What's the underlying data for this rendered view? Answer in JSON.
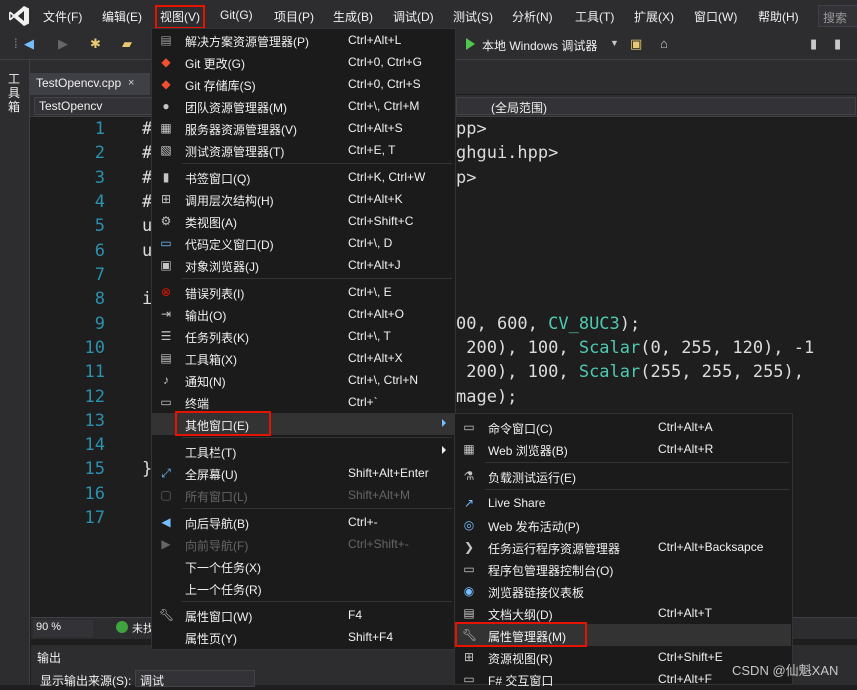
{
  "menubar": {
    "items": [
      "文件(F)",
      "编辑(E)",
      "视图(V)",
      "Git(G)",
      "项目(P)",
      "生成(B)",
      "调试(D)",
      "测试(S)",
      "分析(N)",
      "工具(T)",
      "扩展(X)",
      "窗口(W)",
      "帮助(H)"
    ],
    "search": "搜索"
  },
  "toolbar": {
    "run_label": "本地 Windows 调试器"
  },
  "left_tool": {
    "label": "工具箱"
  },
  "tab": {
    "file": "TestOpencv.cpp",
    "close": "×"
  },
  "navbar": {
    "project": "TestOpencv",
    "scope": "(全局范围)"
  },
  "editor": {
    "line_numbers": [
      "1",
      "2",
      "3",
      "4",
      "5",
      "6",
      "7",
      "8",
      "9",
      "10",
      "11",
      "12",
      "13",
      "14",
      "15",
      "16",
      "17"
    ],
    "code": {
      "l1a": "#",
      "l1b": "pp>",
      "l2a": "#",
      "l2b": "ghgui.hpp>",
      "l3a": "#",
      "l3b": "p>",
      "l4a": "#",
      "l5a": "u",
      "l6a": "u",
      "l8a": "i",
      "l9b": "00, 600, ",
      "l9t": "CV_8UC3",
      "l9c": ");",
      "l10b": " 200), 100, ",
      "l10t": "Scalar",
      "l10c": "(0, 255, 120), -1",
      "l11b": " 200), 100, ",
      "l11t": "Scalar",
      "l11c": "(255, 255, 255),",
      "l12b": "mage);",
      "l15a": "}"
    }
  },
  "status": {
    "zoom": "90 %",
    "errors": "未找"
  },
  "output": {
    "title": "输出",
    "source_label": "显示输出来源(S):",
    "source_value": "调试"
  },
  "view_menu": {
    "items": [
      {
        "label": "解决方案资源管理器(P)",
        "shortcut": "Ctrl+Alt+L",
        "icon": "solution-explorer-icon"
      },
      {
        "label": "Git 更改(G)",
        "shortcut": "Ctrl+0, Ctrl+G",
        "icon": "git-changes-icon"
      },
      {
        "label": "Git 存储库(S)",
        "shortcut": "Ctrl+0, Ctrl+S",
        "icon": "git-repository-icon"
      },
      {
        "label": "团队资源管理器(M)",
        "shortcut": "Ctrl+\\, Ctrl+M",
        "icon": "team-explorer-icon"
      },
      {
        "label": "服务器资源管理器(V)",
        "shortcut": "Ctrl+Alt+S",
        "icon": "server-explorer-icon"
      },
      {
        "label": "测试资源管理器(T)",
        "shortcut": "Ctrl+E, T",
        "icon": "test-explorer-icon"
      },
      {
        "label": "书签窗口(Q)",
        "shortcut": "Ctrl+K, Ctrl+W",
        "icon": "bookmark-icon"
      },
      {
        "label": "调用层次结构(H)",
        "shortcut": "Ctrl+Alt+K",
        "icon": "call-hierarchy-icon"
      },
      {
        "label": "类视图(A)",
        "shortcut": "Ctrl+Shift+C",
        "icon": "class-view-icon"
      },
      {
        "label": "代码定义窗口(D)",
        "shortcut": "Ctrl+\\, D",
        "icon": "code-definition-icon"
      },
      {
        "label": "对象浏览器(J)",
        "shortcut": "Ctrl+Alt+J",
        "icon": "object-browser-icon"
      },
      {
        "label": "错误列表(I)",
        "shortcut": "Ctrl+\\, E",
        "icon": "error-list-icon"
      },
      {
        "label": "输出(O)",
        "shortcut": "Ctrl+Alt+O",
        "icon": "output-icon"
      },
      {
        "label": "任务列表(K)",
        "shortcut": "Ctrl+\\, T",
        "icon": "task-list-icon"
      },
      {
        "label": "工具箱(X)",
        "shortcut": "Ctrl+Alt+X",
        "icon": "toolbox-icon"
      },
      {
        "label": "通知(N)",
        "shortcut": "Ctrl+\\, Ctrl+N",
        "icon": "notification-icon"
      },
      {
        "label": "终端",
        "shortcut": "Ctrl+`",
        "icon": "terminal-icon"
      },
      {
        "label": "其他窗口(E)",
        "shortcut": "",
        "icon": ""
      },
      {
        "label": "工具栏(T)",
        "shortcut": "",
        "icon": ""
      },
      {
        "label": "全屏幕(U)",
        "shortcut": "Shift+Alt+Enter",
        "icon": "fullscreen-icon"
      },
      {
        "label": "所有窗口(L)",
        "shortcut": "Shift+Alt+M",
        "icon": "all-windows-icon"
      },
      {
        "label": "向后导航(B)",
        "shortcut": "Ctrl+-",
        "icon": "navigate-back-icon"
      },
      {
        "label": "向前导航(F)",
        "shortcut": "Ctrl+Shift+-",
        "icon": "navigate-forward-icon"
      },
      {
        "label": "下一个任务(X)",
        "shortcut": "",
        "icon": ""
      },
      {
        "label": "上一个任务(R)",
        "shortcut": "",
        "icon": ""
      },
      {
        "label": "属性窗口(W)",
        "shortcut": "F4",
        "icon": "wrench-icon"
      },
      {
        "label": "属性页(Y)",
        "shortcut": "Shift+F4",
        "icon": ""
      }
    ]
  },
  "other_windows_menu": {
    "items": [
      {
        "label": "命令窗口(C)",
        "shortcut": "Ctrl+Alt+A",
        "icon": "command-window-icon"
      },
      {
        "label": "Web 浏览器(B)",
        "shortcut": "Ctrl+Alt+R",
        "icon": "web-browser-icon"
      },
      {
        "label": "负载测试运行(E)",
        "shortcut": "",
        "icon": "load-test-icon"
      },
      {
        "label": "Live Share",
        "shortcut": "",
        "icon": "live-share-icon"
      },
      {
        "label": "Web 发布活动(P)",
        "shortcut": "",
        "icon": "web-publish-icon"
      },
      {
        "label": "任务运行程序资源管理器",
        "shortcut": "Ctrl+Alt+Backsapce",
        "icon": "task-runner-icon"
      },
      {
        "label": "程序包管理器控制台(O)",
        "shortcut": "",
        "icon": "package-manager-icon"
      },
      {
        "label": "浏览器链接仪表板",
        "shortcut": "",
        "icon": "browser-link-icon"
      },
      {
        "label": "文档大纲(D)",
        "shortcut": "Ctrl+Alt+T",
        "icon": "document-outline-icon"
      },
      {
        "label": "属性管理器(M)",
        "shortcut": "",
        "icon": "wrench-icon"
      },
      {
        "label": "资源视图(R)",
        "shortcut": "Ctrl+Shift+E",
        "icon": "resource-view-icon"
      },
      {
        "label": "F# 交互窗口",
        "shortcut": "Ctrl+Alt+F",
        "icon": "fsharp-interactive-icon"
      }
    ]
  },
  "watermark": "CSDN @仙魁XAN"
}
